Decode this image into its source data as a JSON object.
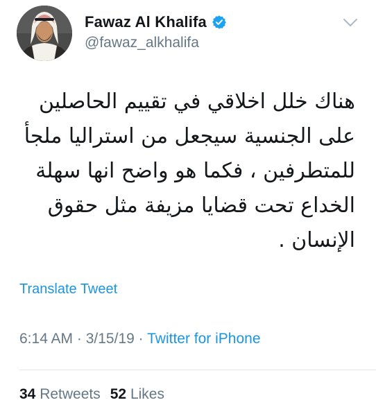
{
  "author": {
    "display_name": "Fawaz Al Khalifa",
    "handle": "@fawaz_alkhalifa",
    "verified": true
  },
  "icons": {
    "verified": "verified-badge-icon",
    "more": "chevron-down-icon"
  },
  "colors": {
    "link": "#1b95e0",
    "secondary_text": "#657786",
    "primary_text": "#14171a",
    "divider": "#e1e8ed"
  },
  "tweet": {
    "text_lines": [
      "هناك خلل اخلاقي في تقييم الحاصلين",
      "على الجنسية سيجعل من استراليا ملجأ",
      "للمتطرفين ، فكما هو واضح انها سهلة",
      "الخداع تحت قضايا مزيفة مثل حقوق",
      "الإنسان ."
    ],
    "translate_label": "Translate Tweet"
  },
  "meta": {
    "time": "6:14 AM",
    "separator": " · ",
    "date": "3/15/19",
    "source": "Twitter for iPhone"
  },
  "stats": {
    "retweets_count": "34",
    "retweets_label": "Retweets",
    "likes_count": "52",
    "likes_label": "Likes"
  }
}
